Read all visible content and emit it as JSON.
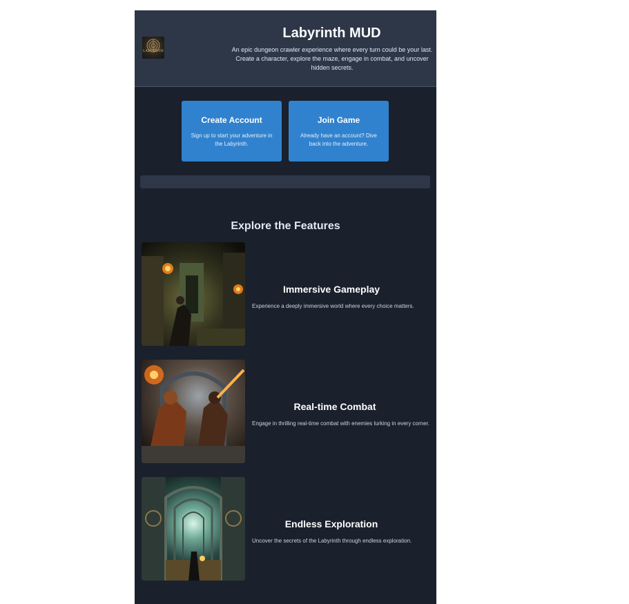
{
  "header": {
    "logo_text": "LABYRINTH",
    "title": "Labyrinth MUD",
    "description": "An epic dungeon crawler experience where every turn could be your last. Create a character, explore the maze, engage in combat, and uncover hidden secrets."
  },
  "actions": [
    {
      "title": "Create Account",
      "description": "Sign up to start your adventure in the Labyrinth."
    },
    {
      "title": "Join Game",
      "description": "Already have an account? Dive back into the adventure."
    }
  ],
  "features": {
    "heading": "Explore the Features",
    "items": [
      {
        "title": "Immersive Gameplay",
        "description": "Experience a deeply immersive world where every choice matters.",
        "image": "dungeon-corridor-torches-image"
      },
      {
        "title": "Real-time Combat",
        "description": "Engage in thrilling real-time combat with enemies lurking in every corner.",
        "image": "warriors-fighting-image"
      },
      {
        "title": "Endless Exploration",
        "description": "Uncover the secrets of the Labyrinth through endless exploration.",
        "image": "maze-archway-image"
      }
    ]
  }
}
